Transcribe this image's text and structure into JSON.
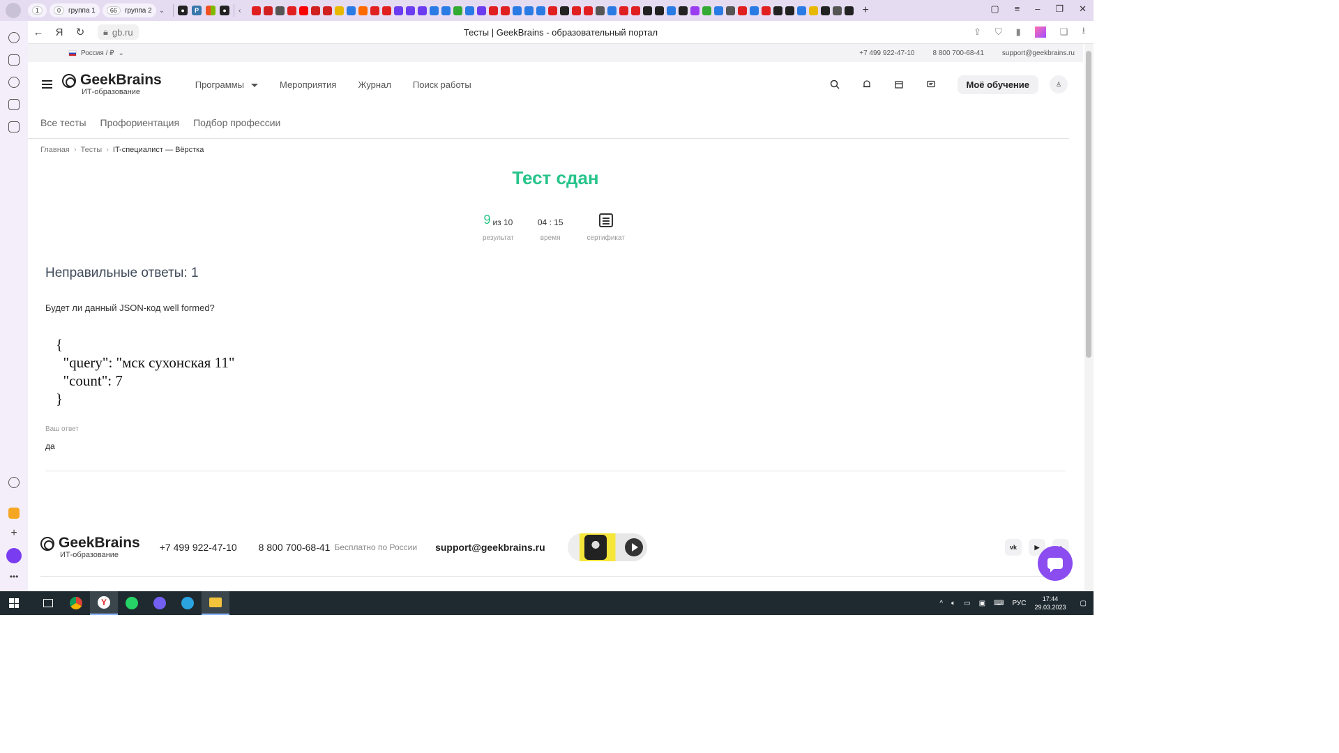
{
  "browser": {
    "tab_groups": [
      {
        "count": "1",
        "label": ""
      },
      {
        "count": "0",
        "label": "группа 1"
      },
      {
        "count": "66",
        "label": "группа 2"
      }
    ],
    "url": "gb.ru",
    "page_title": "Тесты | GeekBrains - образовательный портал"
  },
  "topstrip": {
    "region": "Россия / ₽",
    "phone1": "+7 499 922-47-10",
    "phone2": "8 800 700-68-41",
    "email": "support@geekbrains.ru"
  },
  "header": {
    "logo_name": "GeekBrains",
    "logo_sub": "ИТ-образование",
    "nav": [
      "Программы",
      "Мероприятия",
      "Журнал",
      "Поиск работы"
    ],
    "my_learning": "Моё обучение"
  },
  "subnav": [
    "Все тесты",
    "Профориентация",
    "Подбор профессии"
  ],
  "breadcrumbs": [
    "Главная",
    "Тесты",
    "IT-специалист — Вёрстка"
  ],
  "result": {
    "title": "Тест сдан",
    "score": "9",
    "score_of": "из 10",
    "score_label": "результат",
    "time": "04 : 15",
    "time_label": "время",
    "cert_label": "сертификат"
  },
  "wrong_answers": {
    "heading": "Неправильные ответы: 1",
    "question": "Будет ли данный JSON-код well formed?",
    "code": "{\n  \"query\": \"мск сухонская 11\"\n  \"count\": 7\n}",
    "answer_label": "Ваш ответ",
    "answer": "да"
  },
  "footer": {
    "logo_name": "GeekBrains",
    "logo_sub": "ИТ-образование",
    "phone1": "+7 499 922-47-10",
    "phone2": "8 800 700-68-41",
    "phone2_note": "Бесплатно по России",
    "email": "support@geekbrains.ru",
    "social": [
      "vk-icon",
      "youtube-icon",
      "telegram-icon"
    ]
  },
  "taskbar": {
    "lang": "РУС",
    "time": "17:44",
    "date": "29.03.2023"
  },
  "colors": {
    "accent_green": "#27c48a",
    "chat_purple": "#8b4cf0",
    "browser_tabbar": "#e6dcf2"
  }
}
